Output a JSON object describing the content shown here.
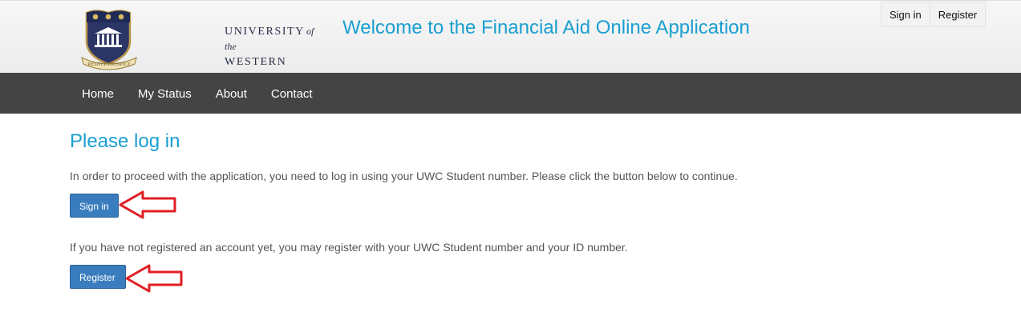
{
  "header": {
    "logo_line1": "UNIVERSITY",
    "logo_line1_suffix": "of the",
    "logo_line2": "WESTERN CAPE",
    "logo_motto": "RESPICE PROSPICE",
    "title": "Welcome to the Financial Aid Online Application",
    "buttons": [
      {
        "label": "Sign in"
      },
      {
        "label": "Register"
      }
    ]
  },
  "nav": {
    "items": [
      {
        "label": "Home"
      },
      {
        "label": "My Status"
      },
      {
        "label": "About"
      },
      {
        "label": "Contact"
      }
    ]
  },
  "main": {
    "heading": "Please log in",
    "login_text": "In order to proceed with the application, you need to log in using your UWC Student number. Please click the button below to continue.",
    "signin_button": "Sign in",
    "register_text": "If you have not registered an account yet, you may register with your UWC Student number and your ID number.",
    "register_button": "Register"
  },
  "colors": {
    "accent": "#1a9fd0",
    "navbar": "#444444",
    "button": "#3a7dbf",
    "annotation_arrow": "#e01e24"
  }
}
